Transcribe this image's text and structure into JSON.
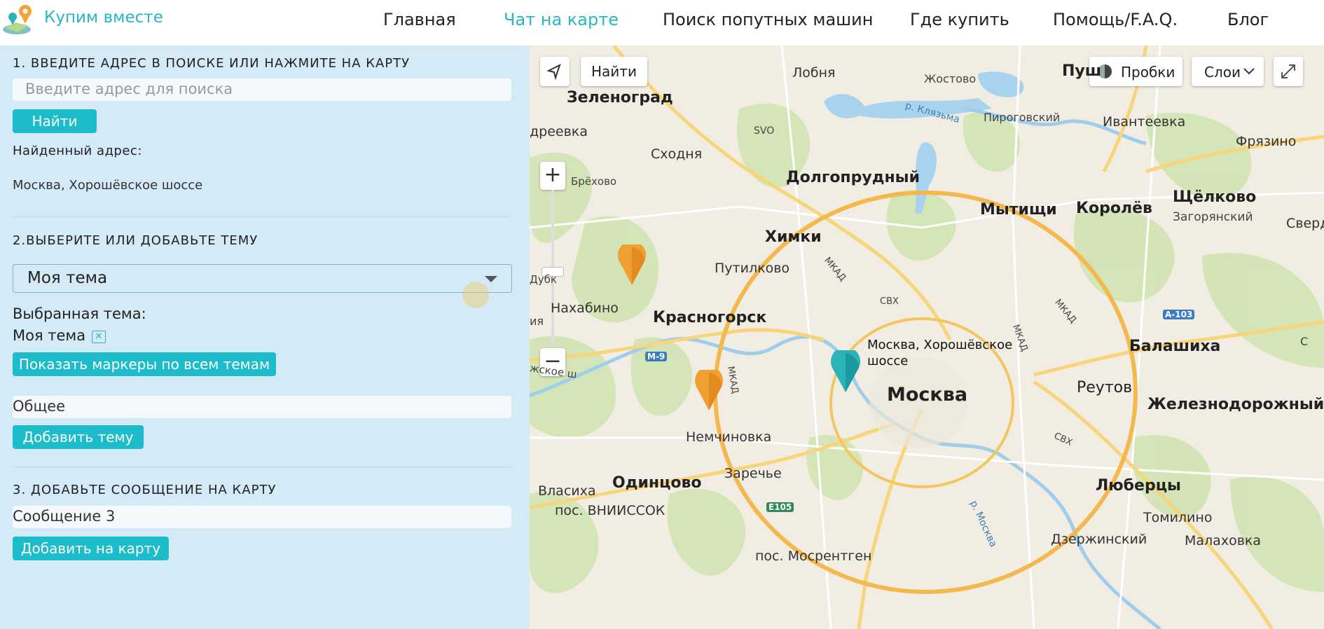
{
  "header": {
    "brand": "Купим вместе",
    "nav": [
      "Главная",
      "Чат на карте",
      "Поиск попутных машин",
      "Где купить",
      "Помощь/F.A.Q.",
      "Блог"
    ],
    "active_index": 1
  },
  "panel": {
    "step1_title": "1. ВВЕДИТЕ АДРЕС В ПОИСКЕ ИЛИ НАЖМИТЕ НА КАРТУ",
    "search_placeholder": "Введите адрес для поиска",
    "find_label": "Найти",
    "found_label": "Найденный адрес:",
    "found_value": "Москва, Хорошёвское шоссе",
    "step2_title": "2.ВЫБЕРИТЕ ИЛИ ДОБАВЬТЕ ТЕМУ",
    "topic_select_value": "Моя тема",
    "selected_topic_label": "Выбранная тема:",
    "selected_topic_value": "Моя тема",
    "show_all_label": "Показать маркеры по всем темам",
    "new_topic_value": "Общее",
    "add_topic_label": "Добавить тему",
    "step3_title": "3. ДОБАВЬТЕ СООБЩЕНИЕ НА КАРТУ",
    "message_value": "Сообщение 3",
    "add_to_map_label": "Добавить на карту"
  },
  "map": {
    "find_label": "Найти",
    "traffic_label": "Пробки",
    "layers_label": "Слои",
    "zoom_in": "+",
    "zoom_out": "−",
    "marker_popup": "Москва, Хорошёвское шоссе",
    "places": {
      "zelenograd": "Зеленоград",
      "lobnya": "Лобня",
      "zhestovo": "Жостово",
      "pushkino": "Пуш",
      "drevka": "дреевка",
      "svo": "SVO",
      "klyazma": "р. Клязьма",
      "pirogovsky": "Пироговский",
      "ivanteevka": "Ивантеевка",
      "fryazino": "Фрязино",
      "skhodnya": "Сходня",
      "dolgoprudny": "Долгопрудный",
      "brekhovo": "Брёхово",
      "mytishchi": "Мытищи",
      "korolev": "Королёв",
      "shchelkovo": "Щёлково",
      "zagoryansky": "Загорянский",
      "sverd": "Сверд",
      "khimki": "Химки",
      "putilkovo": "Путилково",
      "dubki": "Дубк",
      "mkad1": "МКАД",
      "nakhabino": "Нахабино",
      "krasnogorsk": "Красногорск",
      "skhv": "СВХ",
      "a103": "A-103",
      "ia": "ия",
      "balashikha": "Балашиха",
      "m9": "M-9",
      "zhskoe": "жское ш",
      "mkad2": "МКАД",
      "moskva": "Москва",
      "reutov": "Реутов",
      "zheleznodorozhny": "Железнодорожный",
      "nemchinovka": "Немчиновка",
      "svh2": "СВХ",
      "odintsovo": "Одинцово",
      "zarechye": "Заречье",
      "vlasikha": "Власиха",
      "lyubertsy": "Люберцы",
      "vniissok": "пос. ВНИИССОК",
      "e105": "E105",
      "tomilino": "Томилино",
      "moskva_river": "р. Москва",
      "dzerzhinsky": "Дзержинский",
      "malakhovka": "Малаховка",
      "mosrentgen": "пос. Мосрентген",
      "mkad_e": "МКАД",
      "mkad_ne": "МКАД",
      "mkad_w": "МКАД",
      "c": "С"
    }
  },
  "colors": {
    "accent": "#1cbccb",
    "panel_bg": "#d4eaf6",
    "marker_orange": "#f0a030",
    "marker_teal": "#2ab3b8"
  }
}
